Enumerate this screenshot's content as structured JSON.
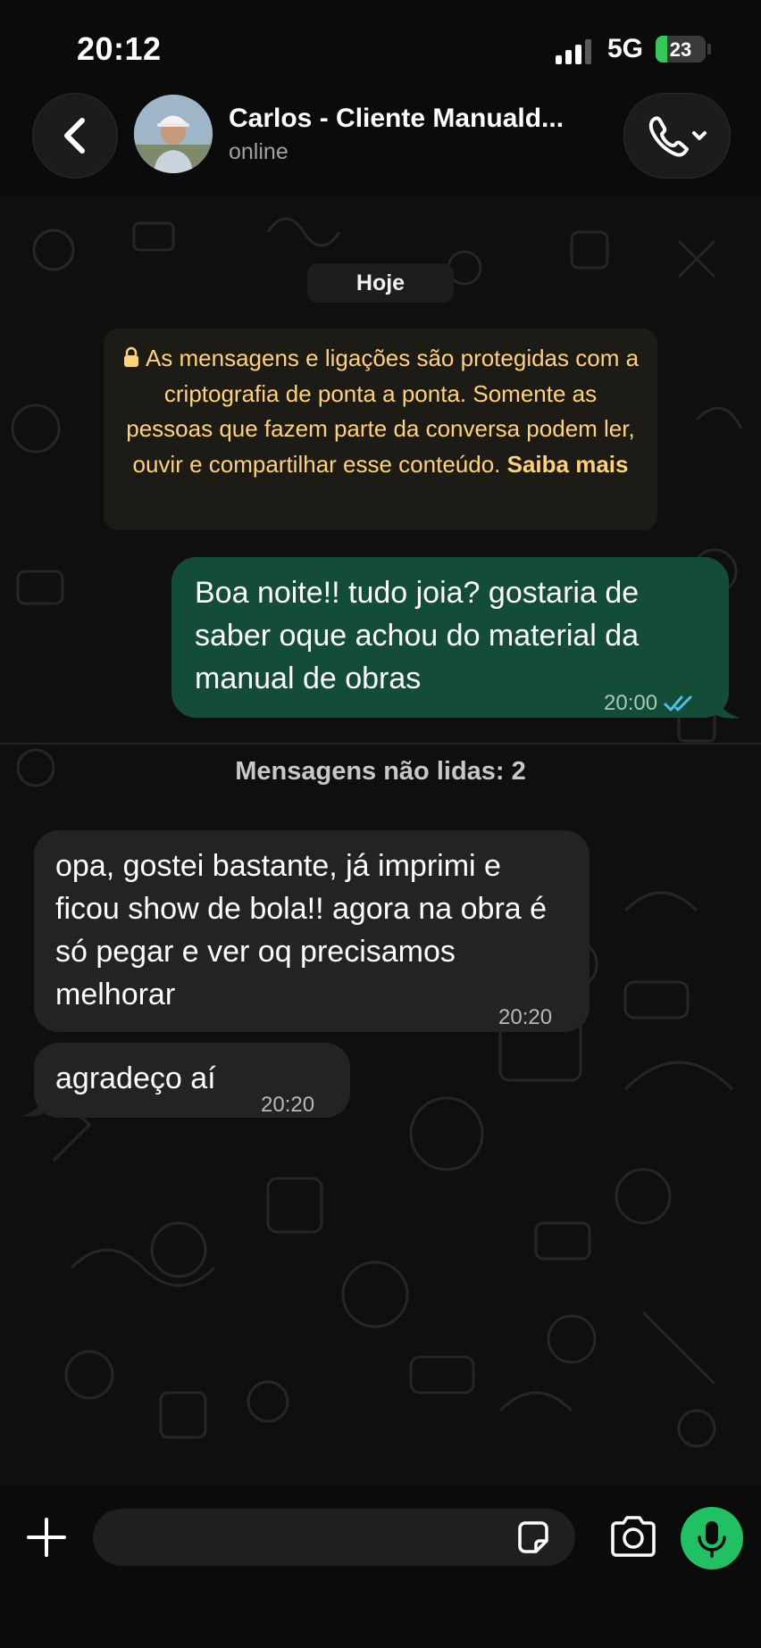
{
  "status_bar": {
    "time": "20:12",
    "network": "5G",
    "battery": "23",
    "battery_level": 0.23
  },
  "header": {
    "contact_name": "Carlos - Cliente Manuald...",
    "contact_status": "online"
  },
  "chat": {
    "date_label": "Hoje",
    "encryption_notice": "As mensagens e ligações são protegidas com a criptografia de ponta a ponta. Somente as pessoas que fazem parte da conversa podem ler, ouvir e compartilhar esse conteúdo.",
    "encryption_link": "Saiba mais",
    "messages_sent": [
      {
        "text": "Boa noite!! tudo joia? gostaria de saber oque achou do material da manual de obras",
        "time": "20:00",
        "status": "read"
      }
    ],
    "unread_label": "Mensagens não lidas: 2",
    "messages_received": [
      {
        "text": "opa, gostei bastante, já imprimi e ficou show de bola!! agora na obra é só pegar e ver oq precisamos melhorar",
        "time": "20:20"
      },
      {
        "text": "agradeço aí",
        "time": "20:20"
      }
    ]
  },
  "icons": {
    "back": "chevron-left-icon",
    "call": "phone-icon",
    "lock": "lock-icon",
    "attach": "plus-icon",
    "sticker": "sticker-icon",
    "camera": "camera-icon",
    "mic": "microphone-icon",
    "read_receipt": "double-check-icon"
  },
  "colors": {
    "accent": "#21c063",
    "outgoing_bubble": "#144d37",
    "incoming_bubble": "#232323",
    "notice_text": "#ffd279",
    "read_ticks": "#53bdeb"
  }
}
